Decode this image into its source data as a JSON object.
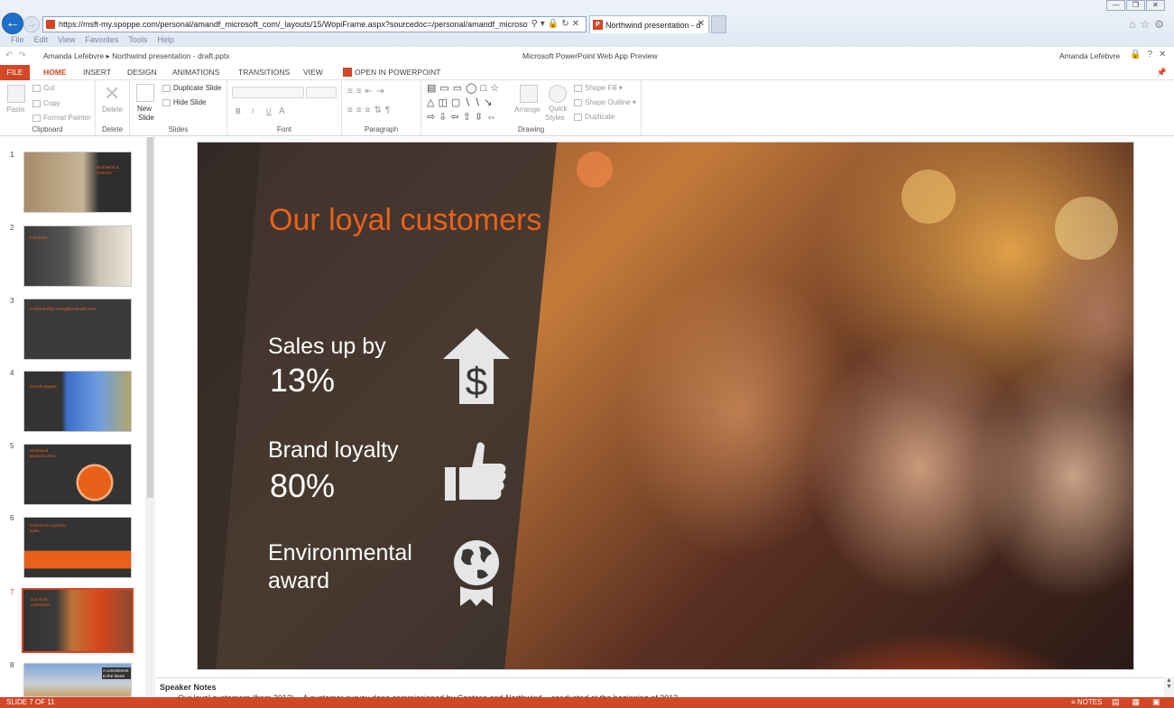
{
  "browser": {
    "url": "https://msft-my.spoppe.com/personal/amandf_microsoft_com/_layouts/15/WopiFrame.aspx?sourcedoc=/personal/amandf_microsoft_com/Docu",
    "tab_title": "Northwind presentation - d...",
    "menu": [
      "File",
      "Edit",
      "View",
      "Favorites",
      "Tools",
      "Help"
    ]
  },
  "header": {
    "breadcrumb_user": "Amanda Lefebvre",
    "breadcrumb_sep": "▸",
    "breadcrumb_file": "Northwind presentation - draft.pptx",
    "app_title": "Microsoft PowerPoint Web App Preview",
    "user_name": "Amanda Lefebvre"
  },
  "ribbon_tabs": {
    "file": "FILE",
    "home": "HOME",
    "insert": "INSERT",
    "design": "DESIGN",
    "animations": "ANIMATIONS",
    "transitions": "TRANSITIONS",
    "view": "VIEW",
    "open_in_powerpoint": "OPEN IN POWERPOINT"
  },
  "ribbon": {
    "clipboard": {
      "label": "Clipboard",
      "paste": "Paste",
      "cut": "Cut",
      "copy": "Copy",
      "format_painter": "Format Painter"
    },
    "delete": {
      "label": "Delete",
      "delete": "Delete"
    },
    "slides": {
      "label": "Slides",
      "new_slide_1": "New",
      "new_slide_2": "Slide",
      "duplicate": "Duplicate Slide",
      "hide": "Hide Slide"
    },
    "font": {
      "label": "Font",
      "bold": "B",
      "italic": "I",
      "underline": "U",
      "color": "A"
    },
    "paragraph": {
      "label": "Paragraph"
    },
    "drawing": {
      "label": "Drawing",
      "arrange": "Arrange",
      "quick_styles_1": "Quick",
      "quick_styles_2": "Styles",
      "shape_fill": "Shape Fill",
      "shape_outline": "Shape Outline",
      "duplicate": "Duplicate"
    }
  },
  "thumbnails": [
    {
      "num": "1",
      "title": "Northwind & Contoso"
    },
    {
      "num": "2",
      "title": "Fast facts"
    },
    {
      "num": "3",
      "title": "A Partnership strengthened with time"
    },
    {
      "num": "4",
      "title": "Growth targets"
    },
    {
      "num": "5",
      "title": "Northwind products 2012"
    },
    {
      "num": "6",
      "title": "Contoso in Contoso sales"
    },
    {
      "num": "7",
      "title": "Our loyal customers"
    },
    {
      "num": "8",
      "title": "A commitment to the future"
    }
  ],
  "slide": {
    "title": "Our loyal customers",
    "stats": [
      {
        "label": "Sales up by",
        "value": "13%",
        "icon": "dollar-up-arrow-icon"
      },
      {
        "label": "Brand loyalty",
        "value": "80%",
        "icon": "thumbs-up-icon"
      },
      {
        "label_line1": "Environmental",
        "label_line2": "award",
        "icon": "globe-award-icon"
      }
    ],
    "colors": {
      "accent": "#e8611a",
      "panel": "#3a3a3a"
    }
  },
  "notes": {
    "label": "Speaker Notes",
    "text": "Our loyal customers (from 2012)... A customer survey done commissioned by Contoso and Northwind... conducted at the beginning of 2013"
  },
  "status": {
    "slide": "SLIDE 7 OF 11",
    "notes": "NOTES"
  }
}
